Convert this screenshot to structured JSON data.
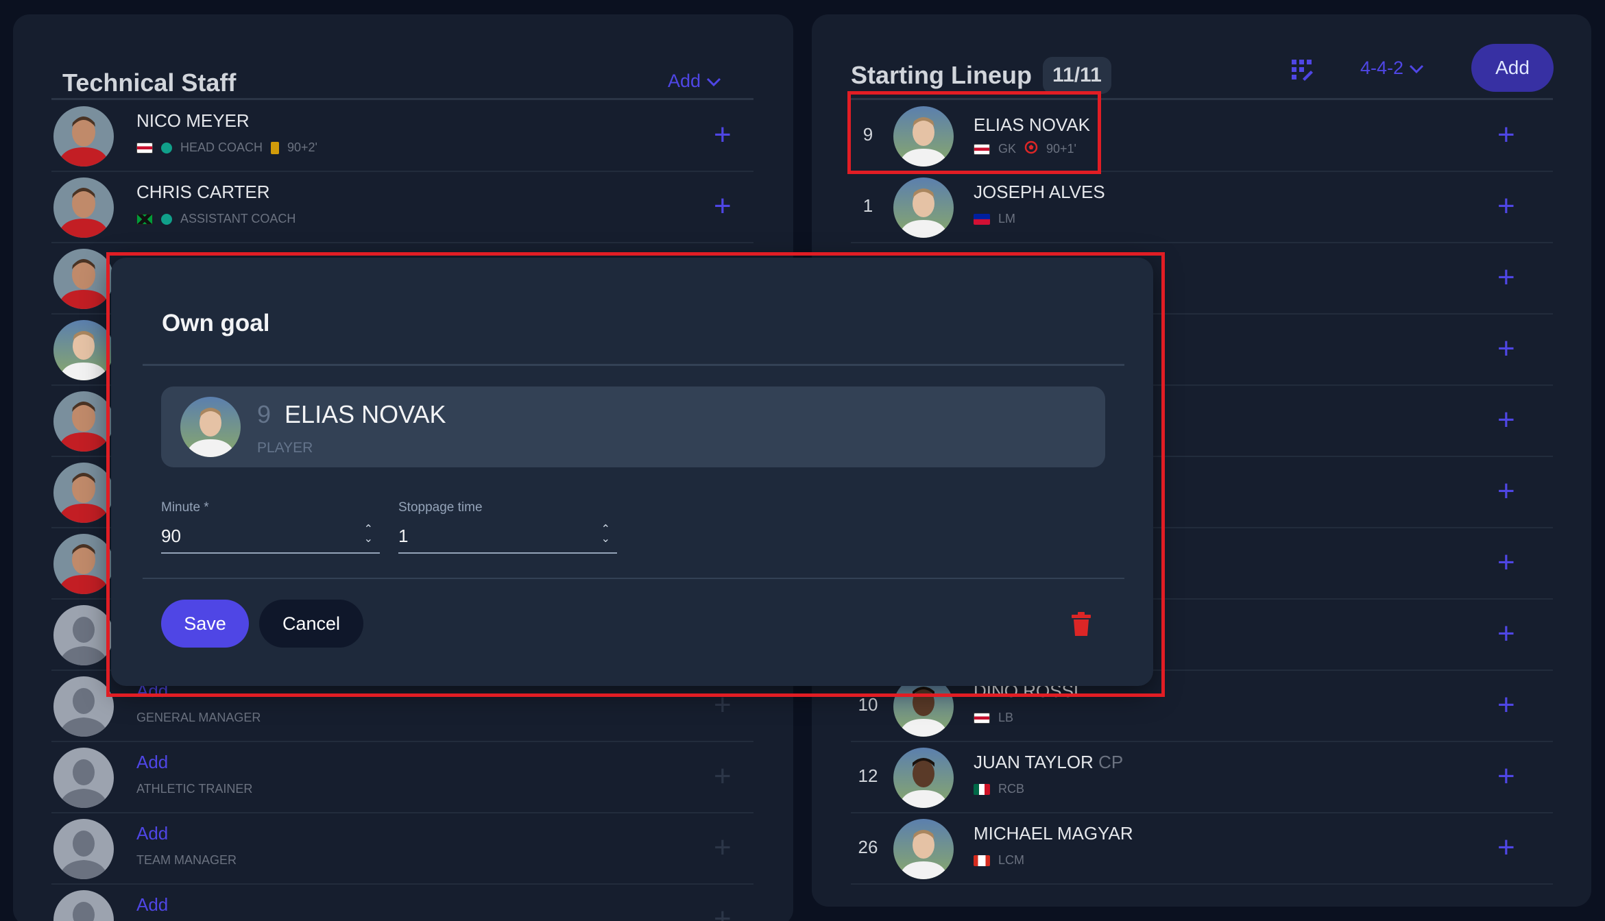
{
  "colors": {
    "accent": "#4f46e5",
    "highlight": "#e11d24",
    "danger": "#dc2626"
  },
  "staff": {
    "title": "Technical Staff",
    "add_label": "Add",
    "rows": [
      {
        "name": "NICO MEYER",
        "role": "HEAD COACH",
        "card_time": "90+2'",
        "filled": true
      },
      {
        "name": "CHRIS CARTER",
        "role": "ASSISTANT COACH",
        "filled": true
      },
      {
        "name": "",
        "role": "",
        "filled": true
      },
      {
        "name": "",
        "role": "",
        "filled": true
      },
      {
        "name": "",
        "role": "",
        "filled": true
      },
      {
        "name": "",
        "role": "",
        "filled": true
      },
      {
        "name": "",
        "role": "",
        "filled": true
      },
      {
        "name": "",
        "role": "",
        "filled": false
      },
      {
        "name": "Add",
        "role": "GENERAL MANAGER",
        "filled": false
      },
      {
        "name": "Add",
        "role": "ATHLETIC TRAINER",
        "filled": false
      },
      {
        "name": "Add",
        "role": "TEAM MANAGER",
        "filled": false
      },
      {
        "name": "Add",
        "role": "",
        "filled": false
      }
    ]
  },
  "lineup": {
    "title": "Starting Lineup",
    "count": "11/11",
    "formation": "4-4-2",
    "add_label": "Add",
    "grid_icon": "formation-grid-icon",
    "rows": [
      {
        "number": "9",
        "name": "ELIAS NOVAK",
        "position": "GK",
        "goal_time": "90+1'"
      },
      {
        "number": "1",
        "name": "JOSEPH ALVES",
        "position": "LM"
      },
      {
        "number": "",
        "name": "",
        "position": ""
      },
      {
        "number": "",
        "name": "",
        "position": ""
      },
      {
        "number": "",
        "name": "",
        "position": ""
      },
      {
        "number": "",
        "name": "",
        "position": ""
      },
      {
        "number": "",
        "name": "",
        "position": ""
      },
      {
        "number": "",
        "name": "",
        "position": ""
      },
      {
        "number": "10",
        "name": "DINO ROSSI",
        "position": "LB"
      },
      {
        "number": "12",
        "name": "JUAN TAYLOR",
        "tag": "CP",
        "position": "RCB"
      },
      {
        "number": "26",
        "name": "MICHAEL MAGYAR",
        "position": "LCM"
      }
    ]
  },
  "modal": {
    "title": "Own goal",
    "player": {
      "number": "9",
      "name": "ELIAS NOVAK",
      "role": "PLAYER"
    },
    "minute_label": "Minute *",
    "minute_value": "90",
    "stoppage_label": "Stoppage time",
    "stoppage_value": "1",
    "save_label": "Save",
    "cancel_label": "Cancel"
  }
}
